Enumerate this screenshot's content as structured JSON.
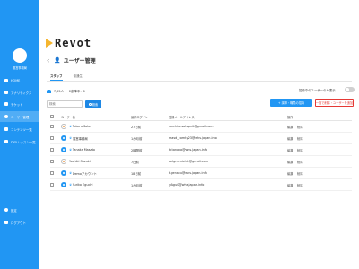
{
  "sidebar": {
    "user_label": "運営事務局",
    "items": [
      {
        "label": "HOME",
        "icon": "home-icon"
      },
      {
        "label": "アナリティクス",
        "icon": "analytics-icon"
      },
      {
        "label": "チケット",
        "icon": "ticket-icon"
      },
      {
        "label": "ユーザー管理",
        "icon": "users-icon",
        "active": true
      },
      {
        "label": "コンテンツ一覧",
        "icon": "content-icon"
      },
      {
        "label": "DIGIレッスン一覧",
        "icon": "lesson-icon"
      },
      {
        "label": "設定",
        "icon": "gear-icon"
      },
      {
        "label": "ログアウト",
        "icon": "logout-icon"
      }
    ]
  },
  "brand": {
    "name": "Revot",
    "accent": "#f5b52e"
  },
  "page": {
    "title": "ユーザー管理"
  },
  "tabs": [
    {
      "label": "スタッフ",
      "active": true
    },
    {
      "label": "普通生"
    }
  ],
  "summary": {
    "total_label": "7,55人",
    "active_label": "2部降中：0"
  },
  "toggle": {
    "label": "招待中のユーザーのみ表示",
    "on": false
  },
  "search": {
    "placeholder": "検索",
    "button_label": "検索"
  },
  "buttons": {
    "invite": "+ 講師・職員の招待",
    "bulk": "一括で削除・ユーザーを追加"
  },
  "table": {
    "headers": {
      "name": "ユーザー名",
      "login": "最終ログイン",
      "email": "登録メールアドレス",
      "actions": "操作"
    },
    "rows": [
      {
        "name": "Takeru Sato",
        "login": "27日前",
        "email": "sorchiro.satepnit@gmail.com",
        "admin": false,
        "avatar": "alt"
      },
      {
        "name": "運営事務局",
        "login": "1か月前",
        "email": "masd_comty23@whs.japan.info",
        "admin": true,
        "avatar": "default"
      },
      {
        "name": "Tanaka Masato",
        "login": "2時間前",
        "email": "tr.tanaka@whs.japan.info",
        "admin": true,
        "avatar": "default"
      },
      {
        "name": "Yoshiki Suzuki",
        "login": "7日前",
        "email": "ahlgr.amishle@gmail.com",
        "admin": false,
        "avatar": "alt"
      },
      {
        "name": "Demoアカウント",
        "login": "18日前",
        "email": "t.genaku@whs.japan.info",
        "admin": true,
        "avatar": "default"
      },
      {
        "name": "Yuriko Eguchi",
        "login": "1か月前",
        "email": "y.Agu0@whs.japan.info",
        "admin": true,
        "avatar": "default"
      }
    ],
    "action_edit": "編集",
    "action_delete": "削除"
  },
  "colors": {
    "primary": "#2196f3",
    "danger": "#e53935"
  }
}
